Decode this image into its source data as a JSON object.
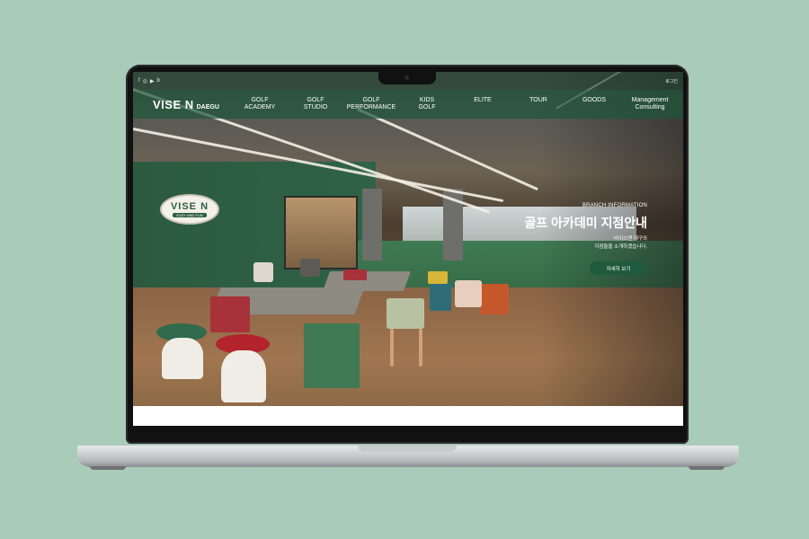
{
  "colors": {
    "background": "#a9cbb9",
    "brand_green": "#1f5a3c"
  },
  "social": {
    "icons": [
      "facebook-icon",
      "instagram-icon",
      "youtube-icon",
      "blog-icon"
    ],
    "glyphs": [
      "f",
      "◎",
      "▶",
      "b"
    ]
  },
  "header": {
    "login": "로그인",
    "brand": "VISE N",
    "brand_sub": "DAEGU",
    "menu": [
      "GOLF\nACADEMY",
      "GOLF\nSTUDIO",
      "GOLF\nPERFORMANCE",
      "KIDS\nGOLF",
      "ELITE",
      "TOUR",
      "GOODS",
      "Management\nConsulting"
    ]
  },
  "hero": {
    "eyebrow": "BRANCH INFORMATION",
    "headline": "골프 아카데미 지점안내",
    "description": "비이스엔 대구의\n지점들을 소개하겠습니다.",
    "cta": "자세히 보기",
    "sign_title": "VISE N",
    "sign_sub": "EASY AND FUN"
  }
}
